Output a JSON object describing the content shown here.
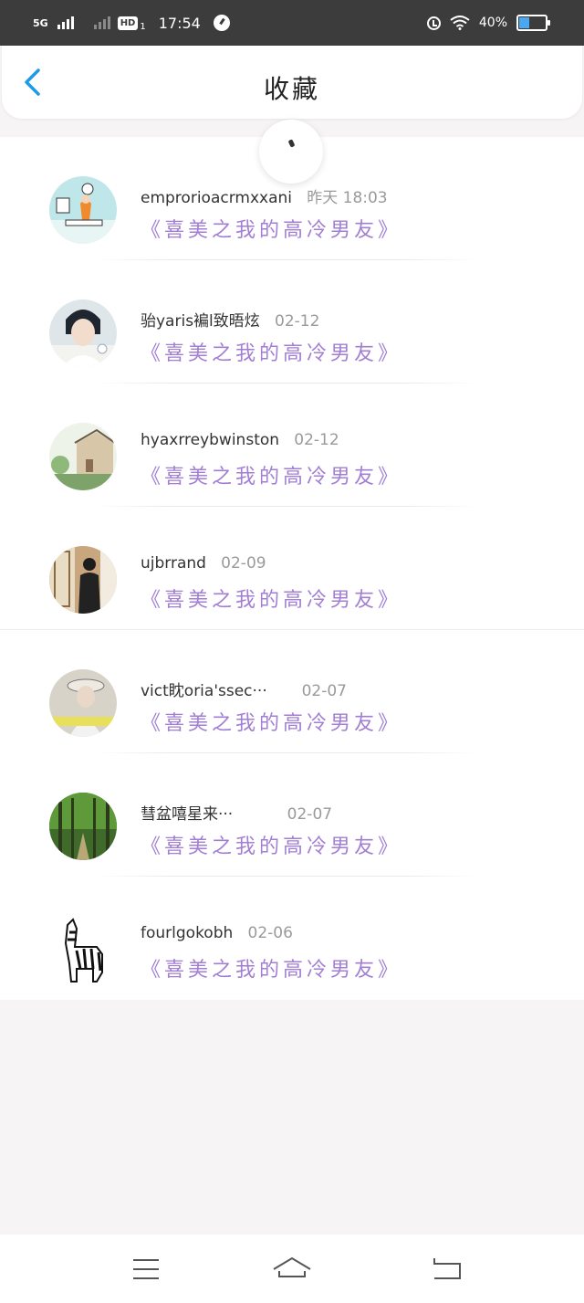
{
  "status_bar": {
    "network": "5G",
    "hd_label": "HD",
    "hd_sub": "1",
    "time": "17:54",
    "battery": "40%",
    "battery_level": 0.4
  },
  "header": {
    "title": "收藏"
  },
  "favorites": [
    {
      "user": "emprorioacrmxxani",
      "date": "昨天 18:03",
      "book": "《喜美之我的高冷男友》",
      "avatar": "illustration-girl"
    },
    {
      "user": "骀yaris褊l致晤炫",
      "date": "02-12",
      "book": "《喜美之我的高冷男友》",
      "avatar": "portrait-boy"
    },
    {
      "user": "hyaxrreybwinston",
      "date": "02-12",
      "book": "《喜美之我的高冷男友》",
      "avatar": "house-garden"
    },
    {
      "user": "ujbrrand",
      "date": "02-09",
      "book": "《喜美之我的高冷男友》",
      "avatar": "man-standing"
    },
    {
      "user": "vict眈oria'ssec···",
      "date": "02-07",
      "book": "《喜美之我的高冷男友》",
      "avatar": "girl-hat"
    },
    {
      "user": "彗盆嘻星来···",
      "date": "02-07",
      "book": "《喜美之我的高冷男友》",
      "avatar": "forest-path"
    },
    {
      "user": "fourlgokobh",
      "date": "02-06",
      "book": "《喜美之我的高冷男友》",
      "avatar": "zebra-toy"
    }
  ],
  "colors": {
    "accent": "#1e9be8",
    "book_title": "#a27fd3",
    "status_bar": "#3c3c3c"
  }
}
